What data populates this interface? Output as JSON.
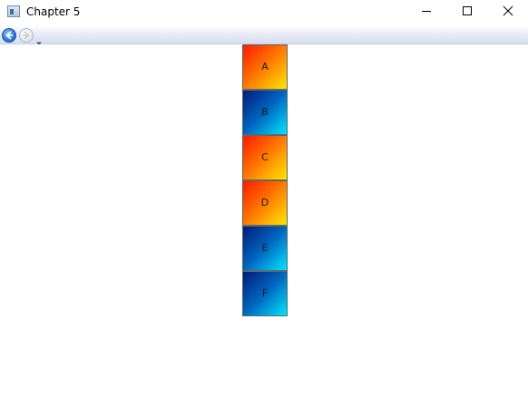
{
  "window": {
    "title": "Chapter 5",
    "controls": [
      "minimize-icon",
      "maximize-icon",
      "close-icon"
    ]
  },
  "navigation": {
    "back_icon": "back-arrow-icon",
    "forward_icon": "forward-arrow-icon",
    "dropdown_icon": "chevron-down-icon"
  },
  "tiles": [
    {
      "label": "A",
      "style": "warm"
    },
    {
      "label": "B",
      "style": "cool"
    },
    {
      "label": "C",
      "style": "warm"
    },
    {
      "label": "D",
      "style": "warm"
    },
    {
      "label": "E",
      "style": "cool"
    },
    {
      "label": "F",
      "style": "cool"
    }
  ],
  "colors": {
    "warm_gradient": [
      "#ff1a00",
      "#ff7a00",
      "#ffe800"
    ],
    "cool_gradient": [
      "#001a7a",
      "#0066c0",
      "#00e6ff"
    ]
  }
}
